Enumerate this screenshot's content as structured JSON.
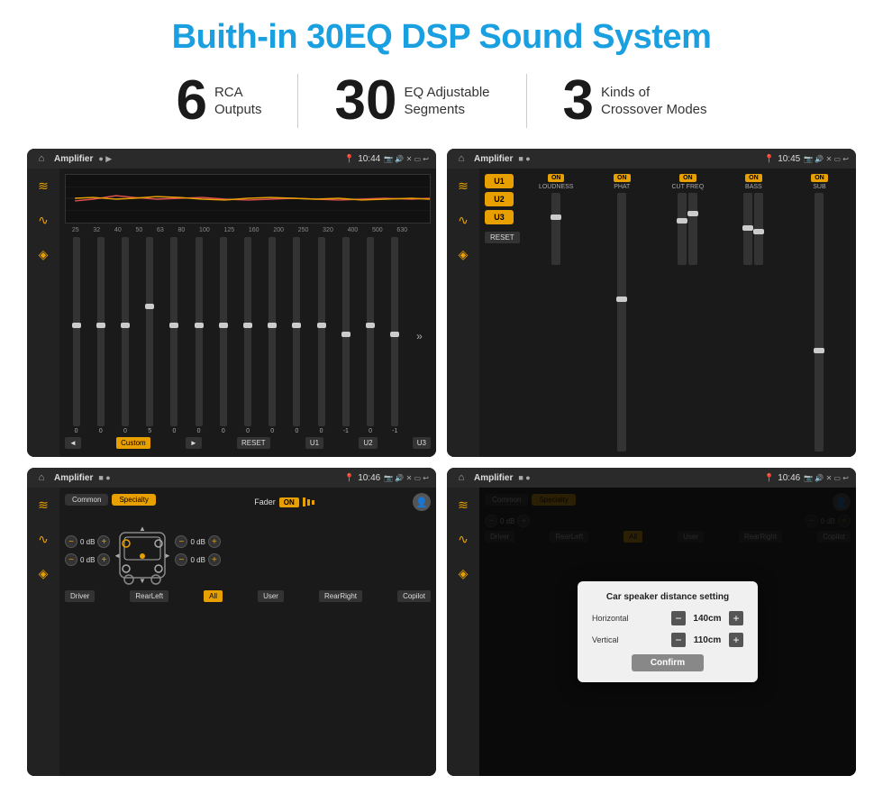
{
  "page": {
    "title": "Buith-in 30EQ DSP Sound System",
    "stats": [
      {
        "number": "6",
        "desc_line1": "RCA",
        "desc_line2": "Outputs"
      },
      {
        "number": "30",
        "desc_line1": "EQ Adjustable",
        "desc_line2": "Segments"
      },
      {
        "number": "3",
        "desc_line1": "Kinds of",
        "desc_line2": "Crossover Modes"
      }
    ]
  },
  "screens": {
    "top_left": {
      "app_name": "Amplifier",
      "time": "10:44",
      "freq_labels": [
        "25",
        "32",
        "40",
        "50",
        "63",
        "80",
        "100",
        "125",
        "160",
        "200",
        "250",
        "320",
        "400",
        "500",
        "630"
      ],
      "eq_values": [
        "0",
        "0",
        "0",
        "5",
        "0",
        "0",
        "0",
        "0",
        "0",
        "0",
        "0",
        "-1",
        "0",
        "-1"
      ],
      "controls": [
        "◄",
        "Custom",
        "►",
        "RESET",
        "U1",
        "U2",
        "U3"
      ]
    },
    "top_right": {
      "app_name": "Amplifier",
      "time": "10:45",
      "presets": [
        "U1",
        "U2",
        "U3"
      ],
      "channels": [
        {
          "toggle": "ON",
          "label": "LOUDNESS"
        },
        {
          "toggle": "ON",
          "label": "PHAT"
        },
        {
          "toggle": "ON",
          "label": "CUT FREQ"
        },
        {
          "toggle": "ON",
          "label": "BASS"
        },
        {
          "toggle": "ON",
          "label": "SUB"
        }
      ],
      "reset_label": "RESET"
    },
    "bottom_left": {
      "app_name": "Amplifier",
      "time": "10:46",
      "tabs": [
        "Common",
        "Specialty"
      ],
      "fader_label": "Fader",
      "fader_on": "ON",
      "volume_controls": [
        {
          "value": "0 dB"
        },
        {
          "value": "0 dB"
        },
        {
          "value": "0 dB"
        },
        {
          "value": "0 dB"
        }
      ],
      "bottom_btns": [
        "Driver",
        "RearLeft",
        "All",
        "User",
        "RearRight",
        "Copilot"
      ]
    },
    "bottom_right": {
      "app_name": "Amplifier",
      "time": "10:46",
      "tabs": [
        "Common",
        "Specialty"
      ],
      "modal": {
        "title": "Car speaker distance setting",
        "horizontal_label": "Horizontal",
        "horizontal_value": "140cm",
        "vertical_label": "Vertical",
        "vertical_value": "110cm",
        "confirm_label": "Confirm"
      },
      "right_controls": [
        {
          "value": "0 dB"
        },
        {
          "value": "0 dB"
        }
      ],
      "bottom_btns": [
        "Driver",
        "RearLeft",
        "All",
        "User",
        "RearRight",
        "Copilot"
      ]
    }
  },
  "icons": {
    "home": "⌂",
    "settings": "≡",
    "dots": "●",
    "play": "▶",
    "play_back": "◄",
    "location": "📍",
    "camera": "📷",
    "volume": "🔊",
    "grid": "⊞",
    "rect": "▭",
    "back_arrow": "↩",
    "equalizer": "≋",
    "wave": "∿",
    "speaker": "◈",
    "minus": "−",
    "plus": "+"
  }
}
